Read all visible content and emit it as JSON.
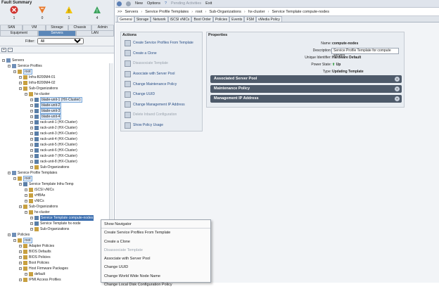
{
  "fault": {
    "title": "Fault Summary",
    "items": [
      {
        "icon": "critical-icon",
        "count": "1"
      },
      {
        "icon": "major-icon",
        "count": "0"
      },
      {
        "icon": "minor-icon",
        "count": "1"
      },
      {
        "icon": "warning-icon",
        "count": "4"
      }
    ]
  },
  "tabs_top": [
    "SAN",
    "VM",
    "Storage",
    "Chassis",
    "Admin"
  ],
  "tabs_bottom": [
    "Equipment",
    "Servers",
    "LAN"
  ],
  "filter": {
    "label": "Filter:",
    "value": "All"
  },
  "tree": [
    {
      "t": "Servers",
      "d": 0
    },
    {
      "t": "Service Profiles",
      "d": 1
    },
    {
      "t": "root",
      "d": 2,
      "hl": true
    },
    {
      "t": "Infra-B200M4-01",
      "d": 3
    },
    {
      "t": "Infra-B200M4-02",
      "d": 3
    },
    {
      "t": "Sub-Organizations",
      "d": 3
    },
    {
      "t": "hx-cluster",
      "d": 4
    },
    {
      "t": "blade-unit-1 (HX-Cluster)",
      "d": 5,
      "hl": true
    },
    {
      "t": "blade-unit-2",
      "d": 5,
      "hl": true
    },
    {
      "t": "blade-unit-3",
      "d": 5,
      "hl": true
    },
    {
      "t": "blade-unit-4",
      "d": 5,
      "hl": true
    },
    {
      "t": "rack-unit-1 (HX-Cluster)",
      "d": 5
    },
    {
      "t": "rack-unit-2 (HX-Cluster)",
      "d": 5
    },
    {
      "t": "rack-unit-3 (HX-Cluster)",
      "d": 5
    },
    {
      "t": "rack-unit-4 (HX-Cluster)",
      "d": 5
    },
    {
      "t": "rack-unit-5 (HX-Cluster)",
      "d": 5
    },
    {
      "t": "rack-unit-6 (HX-Cluster)",
      "d": 5
    },
    {
      "t": "rack-unit-7 (HX-Cluster)",
      "d": 5
    },
    {
      "t": "rack-unit-8 (HX-Cluster)",
      "d": 5
    },
    {
      "t": "Sub-Organizations",
      "d": 5
    },
    {
      "t": "Service Profile Templates",
      "d": 1
    },
    {
      "t": "root",
      "d": 2,
      "hl": true
    },
    {
      "t": "Service Template Infra-Temp",
      "d": 3
    },
    {
      "t": "iSCSI vNICs",
      "d": 4
    },
    {
      "t": "vHBAs",
      "d": 4
    },
    {
      "t": "vNICs",
      "d": 4
    },
    {
      "t": "Sub-Organizations",
      "d": 3
    },
    {
      "t": "hx-cluster",
      "d": 4
    },
    {
      "t": "Service Template compute-nodes",
      "d": 5,
      "sel": true
    },
    {
      "t": "Service Template hx-node",
      "d": 5
    },
    {
      "t": "Sub-Organizations",
      "d": 5
    },
    {
      "t": "Policies",
      "d": 1
    },
    {
      "t": "root",
      "d": 2,
      "hl": true
    },
    {
      "t": "Adapter Policies",
      "d": 3
    },
    {
      "t": "BIOS Defaults",
      "d": 3
    },
    {
      "t": "BIOS Policies",
      "d": 3
    },
    {
      "t": "Boot Policies",
      "d": 3
    },
    {
      "t": "Host Firmware Packages",
      "d": 3
    },
    {
      "t": "default",
      "d": 4
    },
    {
      "t": "IPMI Access Profiles",
      "d": 3
    }
  ],
  "topbar": {
    "new": "New",
    "options": "Options",
    "pending": "Pending Activities",
    "exit": "Exit"
  },
  "breadcrumb": [
    ">>",
    "Servers",
    "Service Profile Templates",
    "root",
    "Sub-Organizations",
    "hx-cluster",
    "Service Template compute-nodes"
  ],
  "content_tabs": [
    "General",
    "Storage",
    "Network",
    "iSCSI vNICs",
    "Boot Order",
    "Policies",
    "Events",
    "FSM",
    "vMedia Policy"
  ],
  "actions": {
    "title": "Actions",
    "items": [
      {
        "label": "Create Service Profiles From Template",
        "dis": false
      },
      {
        "label": "Create a Clone",
        "dis": false
      },
      {
        "label": "Disassociate Template",
        "dis": true
      },
      {
        "label": "Associate with Server Pool",
        "dis": false
      },
      {
        "label": "Change Maintenance Policy",
        "dis": false
      },
      {
        "label": "Change UUID",
        "dis": false
      },
      {
        "label": "Change Management IP Address",
        "dis": false
      },
      {
        "label": "Delete Inband Configuration",
        "dis": true
      },
      {
        "label": "Show Policy Usage",
        "dis": false
      }
    ]
  },
  "properties": {
    "title": "Properties",
    "name_label": "Name:",
    "name": "compute-nodes",
    "desc_label": "Description:",
    "desc": "Service Profile Template for compute servers",
    "uid_label": "Unique Identifier:",
    "uid": "Hardware Default",
    "power_label": "Power State:",
    "power": "Up",
    "type_label": "Type:",
    "type": "Updating Template"
  },
  "sections": [
    "Associated Server Pool",
    "Maintenance Policy",
    "Management IP Address"
  ],
  "context_menu": [
    {
      "label": "Show Navigator",
      "dis": false
    },
    {
      "label": "Create Service Profiles From Template",
      "dis": false
    },
    {
      "label": "Create a Clone",
      "dis": false
    },
    {
      "label": "Disassociate Template",
      "dis": true
    },
    {
      "label": "Associate with Server Pool",
      "dis": false
    },
    {
      "label": "Change UUID",
      "dis": false
    },
    {
      "label": "Change World Wide Node Name",
      "dis": false
    },
    {
      "label": "Change Local Disk Configuration Policy",
      "dis": false
    }
  ]
}
